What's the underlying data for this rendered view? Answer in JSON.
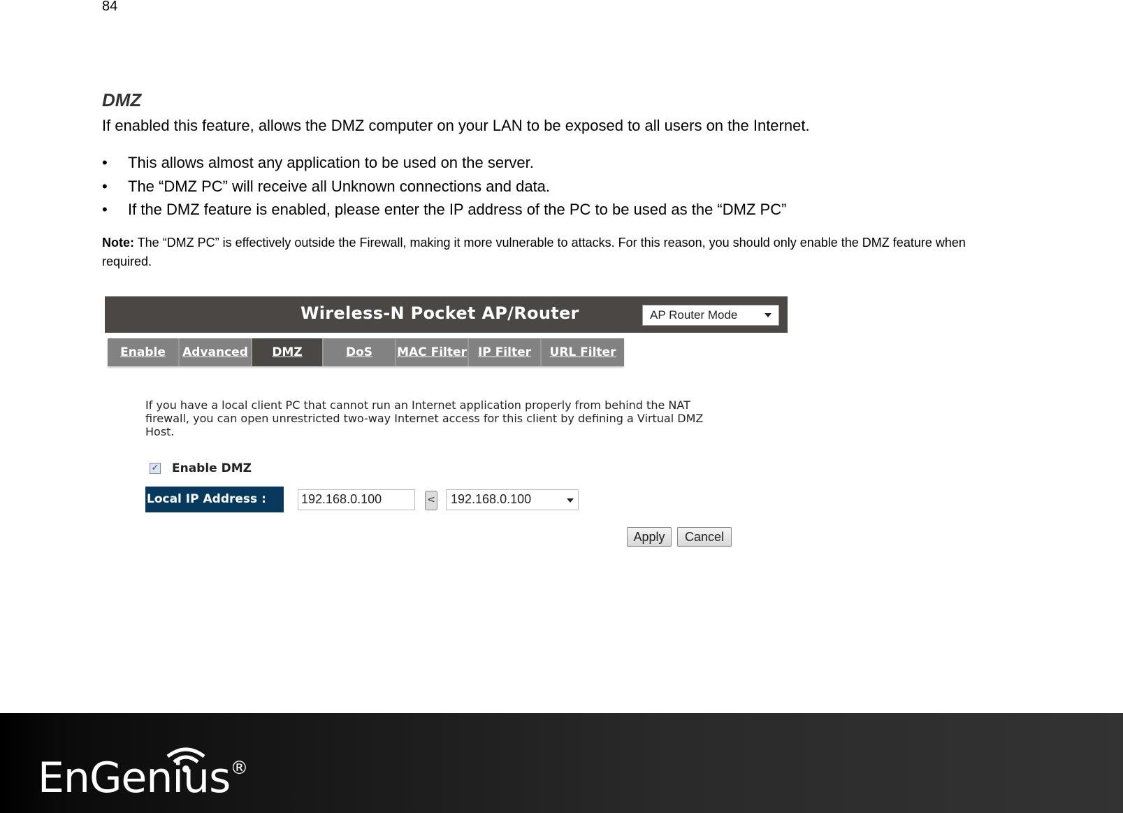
{
  "page_number": "84",
  "section": {
    "title": "DMZ",
    "intro": "If enabled this feature, allows the DMZ computer on your LAN to be exposed to all users on the Internet.",
    "bullets": [
      "This allows almost any application to be used on the server.",
      "The “DMZ PC” will receive all Unknown connections and data.",
      "If the DMZ feature is enabled, please enter the IP address of the PC to be used as the “DMZ PC”"
    ],
    "note_label": "Note:",
    "note_text": " The “DMZ PC” is effectively outside the Firewall, making it more vulnerable to attacks. For this reason, you should only enable the DMZ feature when required."
  },
  "router_ui": {
    "title": "Wireless-N Pocket AP/Router",
    "mode_select": {
      "selected": "AP Router Mode"
    },
    "tabs": [
      {
        "label": "Enable",
        "active": false
      },
      {
        "label": "Advanced",
        "active": false
      },
      {
        "label": "DMZ",
        "active": true
      },
      {
        "label": "DoS",
        "active": false
      },
      {
        "label": "MAC Filter",
        "active": false
      },
      {
        "label": "IP Filter",
        "active": false
      },
      {
        "label": "URL Filter",
        "active": false
      }
    ],
    "description": "If you have a local client PC that cannot run an Internet application properly from behind the NAT firewall, you can open unrestricted two-way Internet access for this client by defining a Virtual DMZ Host.",
    "enable_dmz": {
      "label": "Enable DMZ",
      "checked": true,
      "check_glyph": "✓"
    },
    "local_ip": {
      "label": "Local IP Address :",
      "input_value": "192.168.0.100",
      "copy_button": "<",
      "select_value": "192.168.0.100"
    },
    "buttons": {
      "apply": "Apply",
      "cancel": "Cancel"
    }
  },
  "footer": {
    "brand": "EnGenius",
    "registered": "®",
    "colors": {
      "left": "#000000",
      "right": "#333333"
    }
  }
}
